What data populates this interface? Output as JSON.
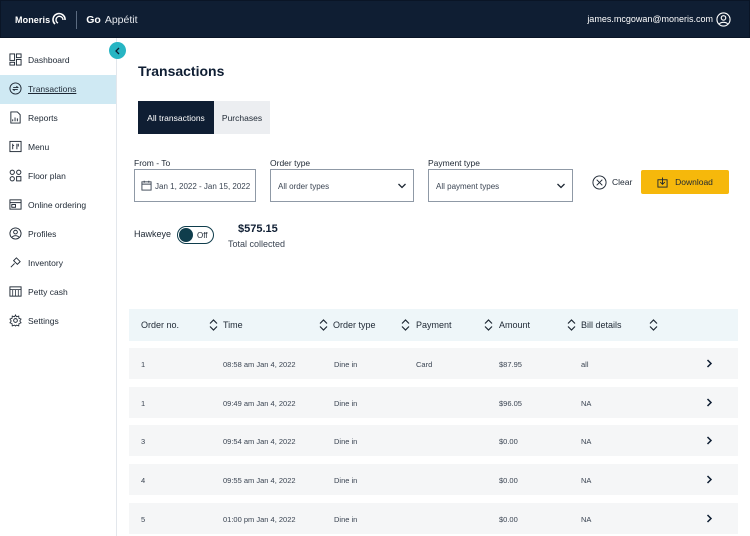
{
  "header": {
    "brand_moneris": "Moneris",
    "brand_go": "Go",
    "brand_appetit": "Appétit",
    "user_email": "james.mcgowan@moneris.com"
  },
  "sidebar": {
    "items": [
      {
        "label": "Dashboard",
        "icon": "dashboard-icon"
      },
      {
        "label": "Transactions",
        "icon": "transactions-icon",
        "active": true
      },
      {
        "label": "Reports",
        "icon": "reports-icon"
      },
      {
        "label": "Menu",
        "icon": "menu-icon"
      },
      {
        "label": "Floor plan",
        "icon": "floor-plan-icon"
      },
      {
        "label": "Online ordering",
        "icon": "online-ordering-icon"
      },
      {
        "label": "Profiles",
        "icon": "profiles-icon"
      },
      {
        "label": "Inventory",
        "icon": "inventory-icon"
      },
      {
        "label": "Petty cash",
        "icon": "petty-cash-icon"
      },
      {
        "label": "Settings",
        "icon": "settings-icon"
      }
    ]
  },
  "page": {
    "title": "Transactions",
    "tabs": [
      {
        "label": "All transactions",
        "active": true
      },
      {
        "label": "Purchases",
        "active": false
      }
    ]
  },
  "filters": {
    "date_label": "From - To",
    "date_value": "Jan 1, 2022 - Jan 15, 2022",
    "order_type_label": "Order type",
    "order_type_value": "All order types",
    "payment_type_label": "Payment type",
    "payment_type_value": "All payment types",
    "clear_label": "Clear",
    "download_label": "Download"
  },
  "summary": {
    "hawkeye_label": "Hawkeye",
    "hawkeye_state": "Off",
    "total_amount": "$575.15",
    "total_label": "Total collected"
  },
  "table": {
    "columns": [
      "Order no.",
      "Time",
      "Order type",
      "Payment",
      "Amount",
      "Bill details"
    ],
    "rows": [
      {
        "order_no": "1",
        "time": "08:58 am Jan 4, 2022",
        "order_type": "Dine in",
        "payment": "Card",
        "amount": "$87.95",
        "bill": "all"
      },
      {
        "order_no": "1",
        "time": "09:49 am Jan 4, 2022",
        "order_type": "Dine in",
        "payment": "",
        "amount": "$96.05",
        "bill": "NA"
      },
      {
        "order_no": "3",
        "time": "09:54 am Jan 4, 2022",
        "order_type": "Dine in",
        "payment": "",
        "amount": "$0.00",
        "bill": "NA"
      },
      {
        "order_no": "4",
        "time": "09:55 am Jan 4, 2022",
        "order_type": "Dine in",
        "payment": "",
        "amount": "$0.00",
        "bill": "NA"
      },
      {
        "order_no": "5",
        "time": "01:00 pm Jan 4, 2022",
        "order_type": "Dine in",
        "payment": "",
        "amount": "$0.00",
        "bill": "NA"
      }
    ]
  },
  "colors": {
    "header_bg": "#0f1e33",
    "accent_teal": "#27b5c3",
    "active_nav_bg": "#cfe9f3",
    "download_yellow": "#f6b80b"
  }
}
